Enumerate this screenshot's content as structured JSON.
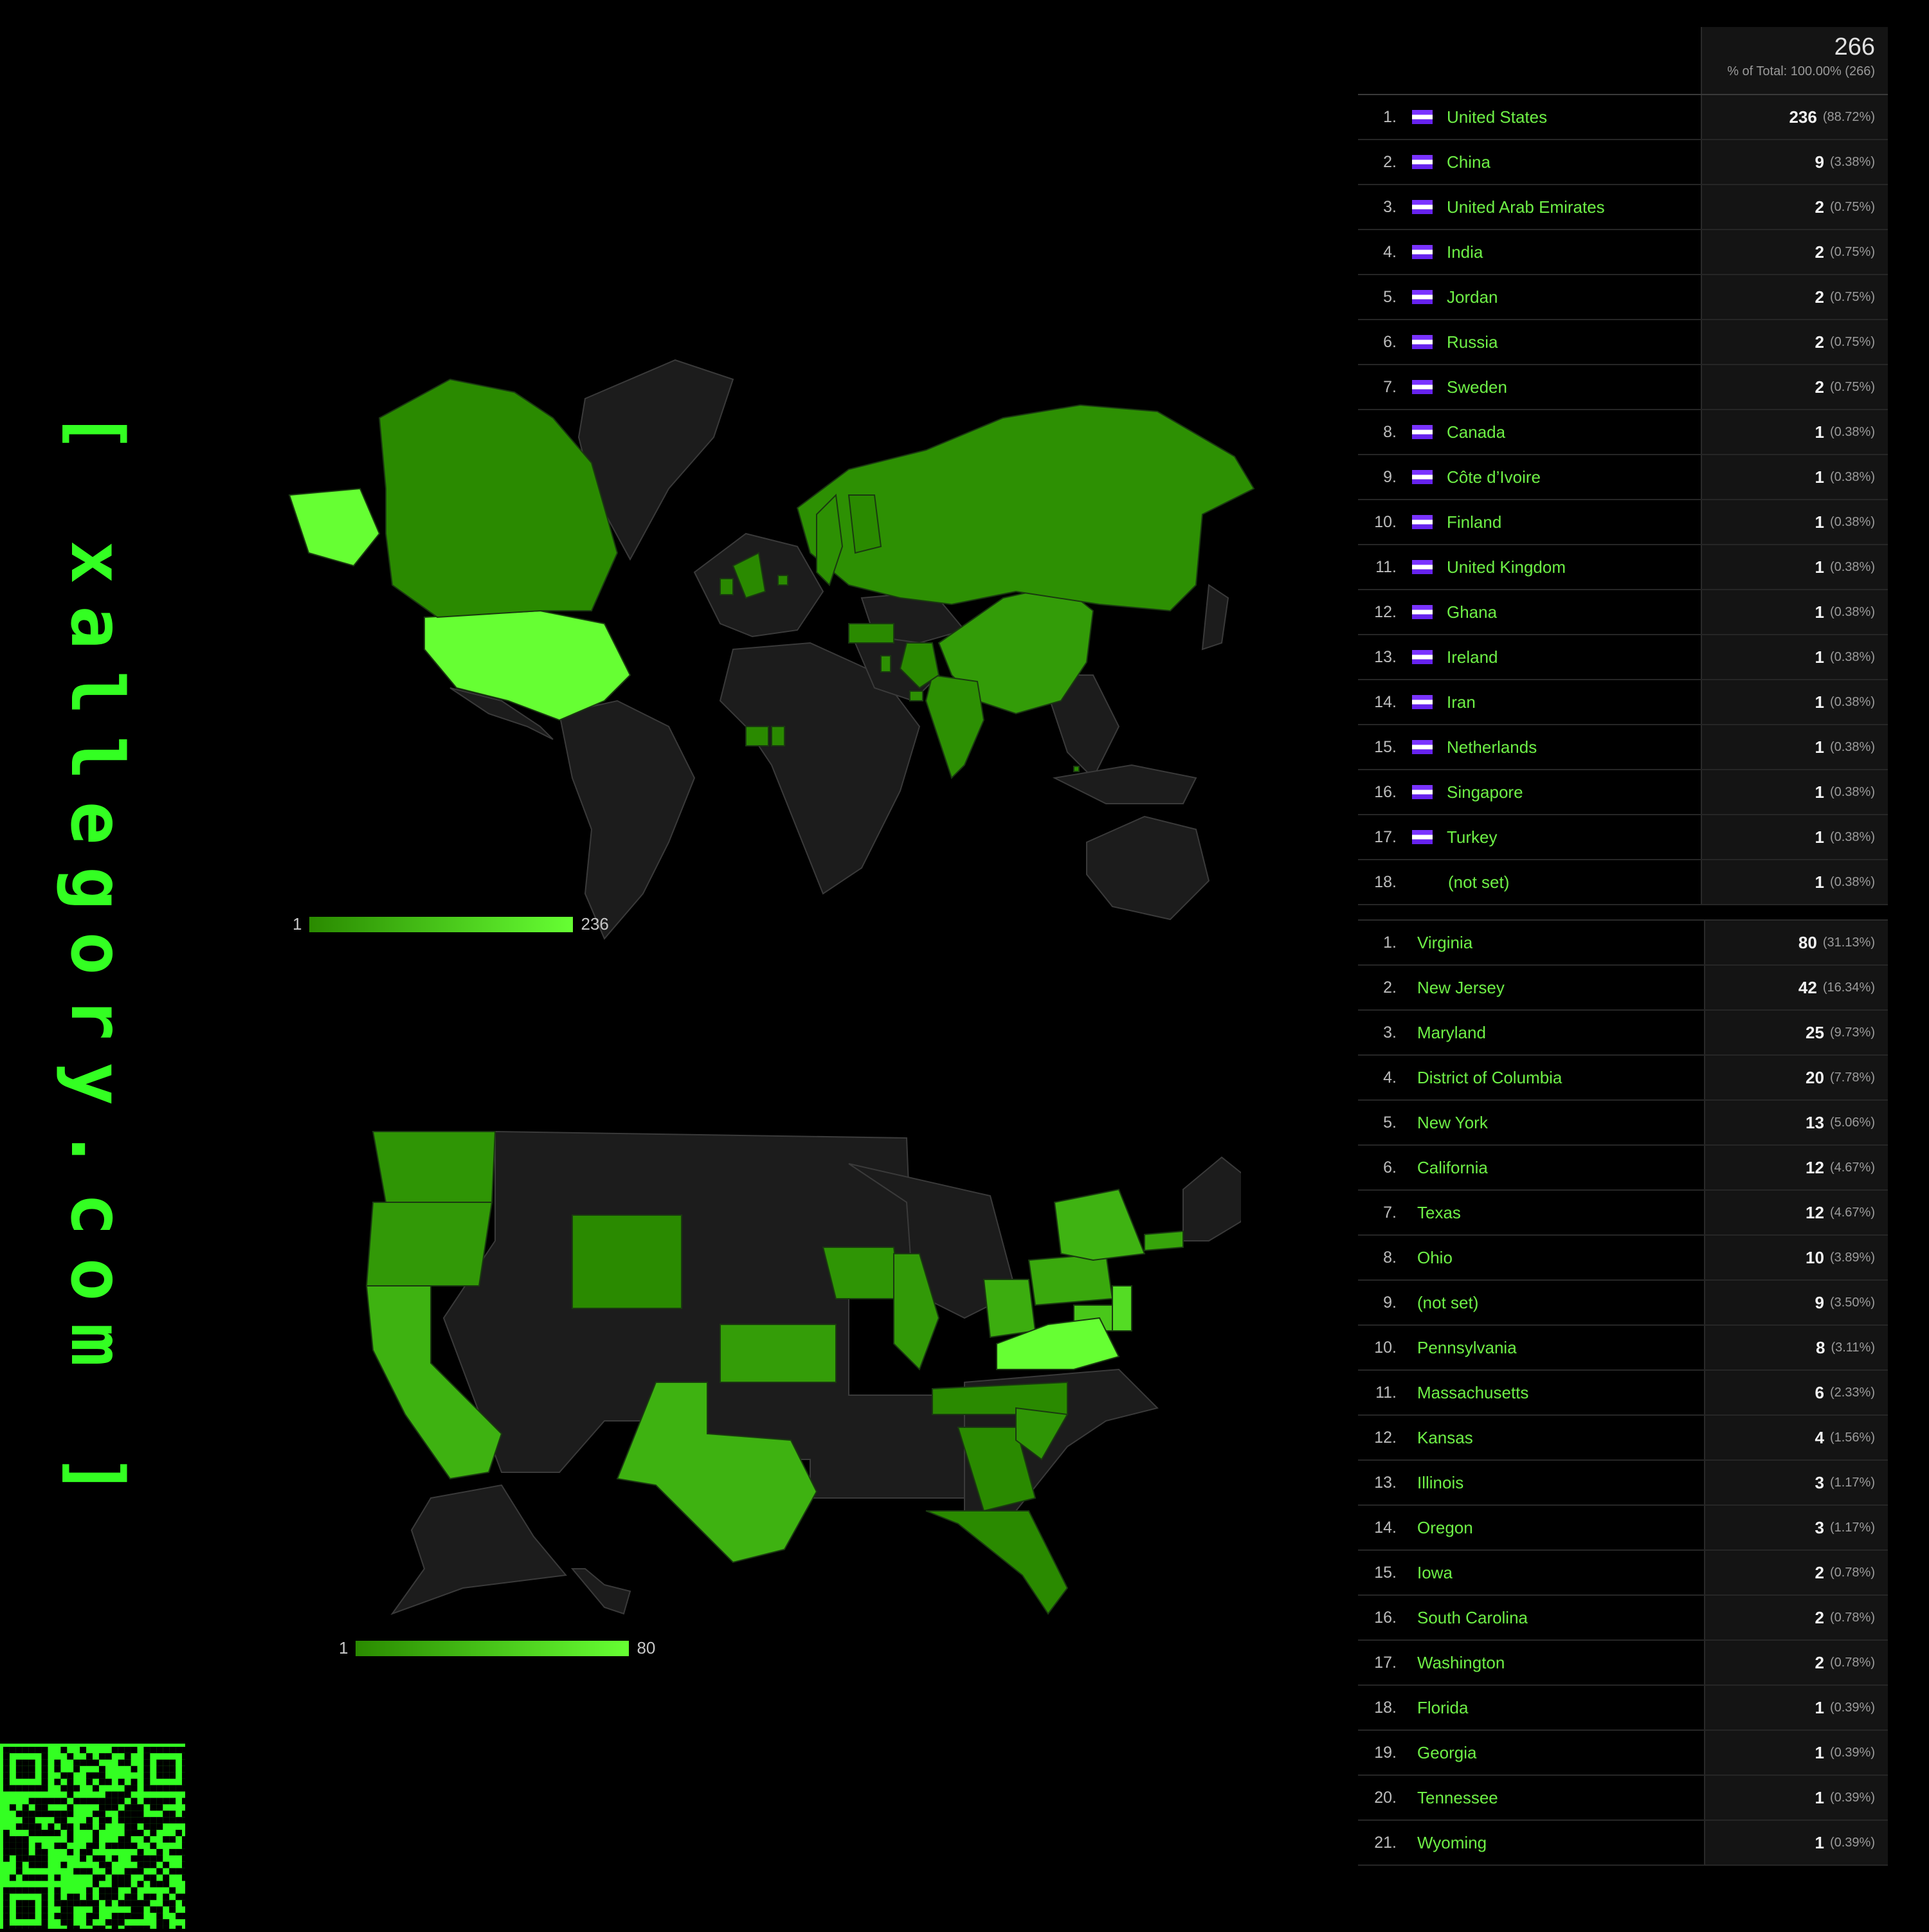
{
  "brand": {
    "site": "[ xallegory.com ]",
    "qr_code": "QR code"
  },
  "colors": {
    "background": "#000000",
    "accent_green": "#33ff22",
    "land_no_data": "#1c1c1c",
    "scale_low": "#2a8a00",
    "scale_high": "#66ff33"
  },
  "world_map": {
    "type": "choropleth",
    "legend_min": "1",
    "legend_max": "236"
  },
  "us_map": {
    "type": "choropleth",
    "legend_min": "1",
    "legend_max": "80"
  },
  "country_table": {
    "total": "266",
    "total_sub": "% of Total: 100.00% (266)",
    "rows": [
      {
        "rank": "1.",
        "name": "United States",
        "value": "236",
        "pct": "(88.72%)"
      },
      {
        "rank": "2.",
        "name": "China",
        "value": "9",
        "pct": "(3.38%)"
      },
      {
        "rank": "3.",
        "name": "United Arab Emirates",
        "value": "2",
        "pct": "(0.75%)"
      },
      {
        "rank": "4.",
        "name": "India",
        "value": "2",
        "pct": "(0.75%)"
      },
      {
        "rank": "5.",
        "name": "Jordan",
        "value": "2",
        "pct": "(0.75%)"
      },
      {
        "rank": "6.",
        "name": "Russia",
        "value": "2",
        "pct": "(0.75%)"
      },
      {
        "rank": "7.",
        "name": "Sweden",
        "value": "2",
        "pct": "(0.75%)"
      },
      {
        "rank": "8.",
        "name": "Canada",
        "value": "1",
        "pct": "(0.38%)"
      },
      {
        "rank": "9.",
        "name": "Côte d’Ivoire",
        "value": "1",
        "pct": "(0.38%)"
      },
      {
        "rank": "10.",
        "name": "Finland",
        "value": "1",
        "pct": "(0.38%)"
      },
      {
        "rank": "11.",
        "name": "United Kingdom",
        "value": "1",
        "pct": "(0.38%)"
      },
      {
        "rank": "12.",
        "name": "Ghana",
        "value": "1",
        "pct": "(0.38%)"
      },
      {
        "rank": "13.",
        "name": "Ireland",
        "value": "1",
        "pct": "(0.38%)"
      },
      {
        "rank": "14.",
        "name": "Iran",
        "value": "1",
        "pct": "(0.38%)"
      },
      {
        "rank": "15.",
        "name": "Netherlands",
        "value": "1",
        "pct": "(0.38%)"
      },
      {
        "rank": "16.",
        "name": "Singapore",
        "value": "1",
        "pct": "(0.38%)"
      },
      {
        "rank": "17.",
        "name": "Turkey",
        "value": "1",
        "pct": "(0.38%)"
      },
      {
        "rank": "18.",
        "name": "(not set)",
        "value": "1",
        "pct": "(0.38%)"
      }
    ]
  },
  "region_table": {
    "rows": [
      {
        "rank": "1.",
        "name": "Virginia",
        "value": "80",
        "pct": "(31.13%)"
      },
      {
        "rank": "2.",
        "name": "New Jersey",
        "value": "42",
        "pct": "(16.34%)"
      },
      {
        "rank": "3.",
        "name": "Maryland",
        "value": "25",
        "pct": "(9.73%)"
      },
      {
        "rank": "4.",
        "name": "District of Columbia",
        "value": "20",
        "pct": "(7.78%)"
      },
      {
        "rank": "5.",
        "name": "New York",
        "value": "13",
        "pct": "(5.06%)"
      },
      {
        "rank": "6.",
        "name": "California",
        "value": "12",
        "pct": "(4.67%)"
      },
      {
        "rank": "7.",
        "name": "Texas",
        "value": "12",
        "pct": "(4.67%)"
      },
      {
        "rank": "8.",
        "name": "Ohio",
        "value": "10",
        "pct": "(3.89%)"
      },
      {
        "rank": "9.",
        "name": "(not set)",
        "value": "9",
        "pct": "(3.50%)"
      },
      {
        "rank": "10.",
        "name": "Pennsylvania",
        "value": "8",
        "pct": "(3.11%)"
      },
      {
        "rank": "11.",
        "name": "Massachusetts",
        "value": "6",
        "pct": "(2.33%)"
      },
      {
        "rank": "12.",
        "name": "Kansas",
        "value": "4",
        "pct": "(1.56%)"
      },
      {
        "rank": "13.",
        "name": "Illinois",
        "value": "3",
        "pct": "(1.17%)"
      },
      {
        "rank": "14.",
        "name": "Oregon",
        "value": "3",
        "pct": "(1.17%)"
      },
      {
        "rank": "15.",
        "name": "Iowa",
        "value": "2",
        "pct": "(0.78%)"
      },
      {
        "rank": "16.",
        "name": "South Carolina",
        "value": "2",
        "pct": "(0.78%)"
      },
      {
        "rank": "17.",
        "name": "Washington",
        "value": "2",
        "pct": "(0.78%)"
      },
      {
        "rank": "18.",
        "name": "Florida",
        "value": "1",
        "pct": "(0.39%)"
      },
      {
        "rank": "19.",
        "name": "Georgia",
        "value": "1",
        "pct": "(0.39%)"
      },
      {
        "rank": "20.",
        "name": "Tennessee",
        "value": "1",
        "pct": "(0.39%)"
      },
      {
        "rank": "21.",
        "name": "Wyoming",
        "value": "1",
        "pct": "(0.39%)"
      }
    ]
  }
}
